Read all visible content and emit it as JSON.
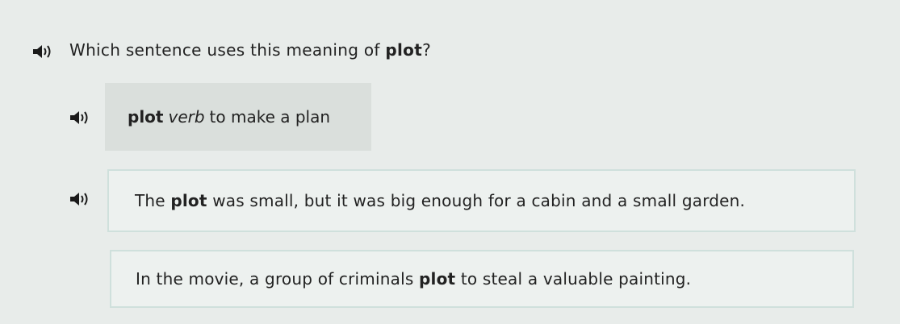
{
  "question": {
    "prefix": "Which sentence uses this meaning of ",
    "keyword": "plot",
    "suffix": "?"
  },
  "definition": {
    "word": "plot",
    "part_of_speech": "verb",
    "meaning": "to make a plan"
  },
  "options": [
    {
      "before": "The ",
      "keyword": "plot",
      "after": " was small, but it was big enough for a cabin and a small garden."
    },
    {
      "before": "In the movie, a group of criminals ",
      "keyword": "plot",
      "after": " to steal a valuable painting."
    }
  ],
  "icons": {
    "audio": "speaker-icon"
  },
  "colors": {
    "background": "#e8ecea",
    "definition_bg": "#dadfdc",
    "option_border": "#cfe0dc",
    "icon": "#1a1a1a"
  }
}
